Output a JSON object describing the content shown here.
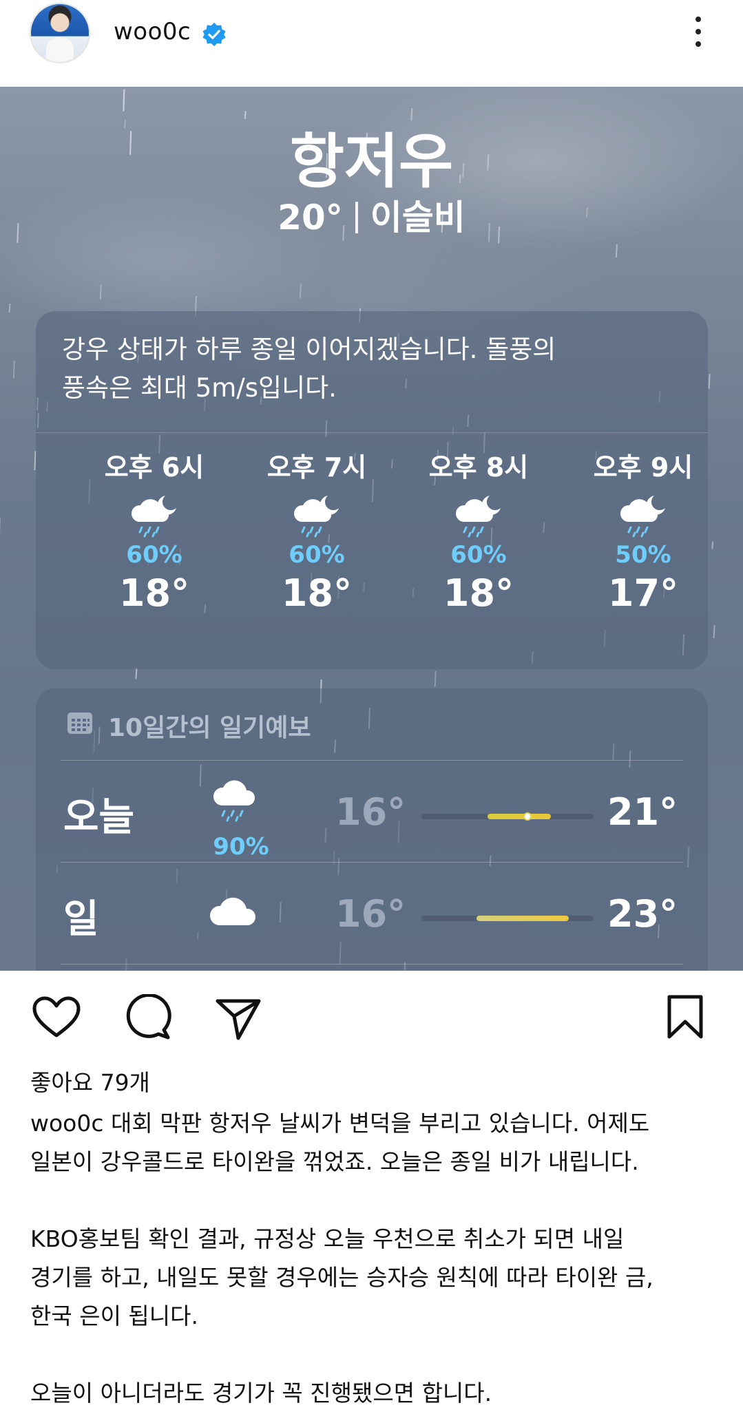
{
  "post_header": {
    "username": "woo0c",
    "verified": true,
    "avatar_icon": "profile-photo",
    "more_icon": "more-vertical-icon"
  },
  "weather": {
    "city": "항저우",
    "current_temp": "20°",
    "condition": "이슬비",
    "summary_line1": "강우 상태가 하루 종일 이어지겠습니다. 돌풍의",
    "summary_line2": "풍속은 최대 5m/s입니다.",
    "hourly": [
      {
        "time": "오후 6시",
        "precip": "60%",
        "temp": "18°",
        "icon": "cloud-moon-rain-icon"
      },
      {
        "time": "오후 7시",
        "precip": "60%",
        "temp": "18°",
        "icon": "cloud-moon-rain-icon"
      },
      {
        "time": "오후 8시",
        "precip": "60%",
        "temp": "18°",
        "icon": "cloud-moon-rain-icon"
      },
      {
        "time": "오후 9시",
        "precip": "50%",
        "temp": "17°",
        "icon": "cloud-moon-rain-icon"
      }
    ],
    "forecast_title": "10일간의 일기예보",
    "forecast": [
      {
        "day": "오늘",
        "precip": "90%",
        "low": "16°",
        "high": "21°",
        "icon": "cloud-rain-icon"
      },
      {
        "day": "일",
        "precip": "",
        "low": "16°",
        "high": "23°",
        "icon": "cloud-icon"
      }
    ],
    "colors": {
      "precip": "#6fcdfb",
      "bar": "#e5d25a"
    }
  },
  "actions": {
    "like_icon": "heart-icon",
    "comment_icon": "comment-icon",
    "share_icon": "send-icon",
    "save_icon": "bookmark-icon"
  },
  "likes_text": "좋아요 79개",
  "caption": {
    "username": "woo0c",
    "line1": "대회 막판 항저우 날씨가 변덕을 부리고 있습니다. 어제도",
    "line2": "일본이 강우콜드로 타이완을 꺾었죠. 오늘은 종일 비가 내립니다.",
    "line3": "KBO홍보팀 확인 결과, 규정상 오늘 우천으로 취소가 되면 내일",
    "line4": "경기를 하고, 내일도 못할 경우에는 승자승 원칙에 따라 타이완 금,",
    "line5": "한국 은이 됩니다.",
    "line6": "오늘이 아니더라도 경기가 꼭 진행됐으면 합니다."
  }
}
